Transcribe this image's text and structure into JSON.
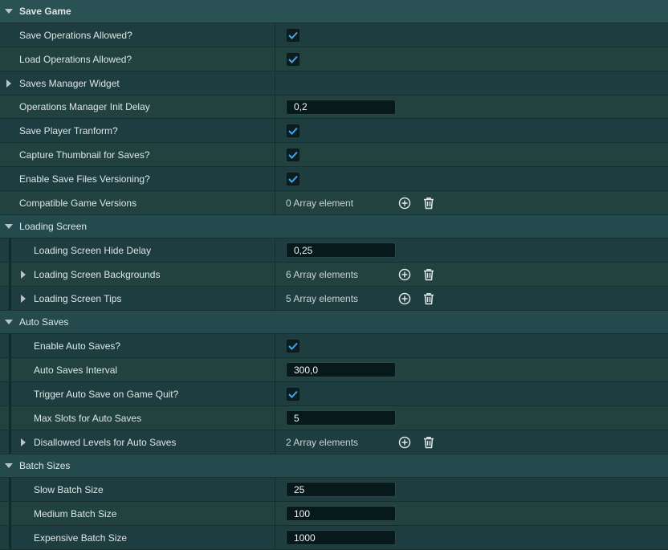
{
  "categories": {
    "save_game": "Save Game",
    "loading_screen": "Loading Screen",
    "auto_saves": "Auto Saves",
    "batch_sizes": "Batch Sizes"
  },
  "properties": {
    "save_ops": {
      "label": "Save Operations Allowed?",
      "checked": true
    },
    "load_ops": {
      "label": "Load Operations Allowed?",
      "checked": true
    },
    "saves_manager_widget": {
      "label": "Saves Manager Widget"
    },
    "ops_manager_init_delay": {
      "label": "Operations Manager Init Delay",
      "value": "0,2"
    },
    "save_player_transform": {
      "label": "Save Player Tranform?",
      "checked": true
    },
    "capture_thumbnail": {
      "label": "Capture Thumbnail for Saves?",
      "checked": true
    },
    "enable_versioning": {
      "label": "Enable Save Files Versioning?",
      "checked": true
    },
    "compatible_versions": {
      "label": "Compatible Game Versions",
      "value": "0 Array element"
    },
    "loading_hide_delay": {
      "label": "Loading Screen Hide Delay",
      "value": "0,25"
    },
    "loading_backgrounds": {
      "label": "Loading Screen Backgrounds",
      "value": "6 Array elements"
    },
    "loading_tips": {
      "label": "Loading Screen Tips",
      "value": "5 Array elements"
    },
    "enable_auto_saves": {
      "label": "Enable Auto Saves?",
      "checked": true
    },
    "auto_saves_interval": {
      "label": "Auto Saves Interval",
      "value": "300,0"
    },
    "trigger_on_quit": {
      "label": "Trigger Auto Save on Game Quit?",
      "checked": true
    },
    "max_slots": {
      "label": "Max Slots for Auto Saves",
      "value": "5"
    },
    "disallowed_levels": {
      "label": "Disallowed Levels for Auto Saves",
      "value": "2 Array elements"
    },
    "slow_batch": {
      "label": "Slow Batch Size",
      "value": "25"
    },
    "medium_batch": {
      "label": "Medium Batch Size",
      "value": "100"
    },
    "expensive_batch": {
      "label": "Expensive Batch Size",
      "value": "1000"
    }
  },
  "icons": {
    "checkmark": "checkmark-icon",
    "add": "add-element-icon",
    "trash": "trash-icon",
    "expand": "triangle-right-icon",
    "collapse": "triangle-down-icon"
  },
  "colors": {
    "background": "#1d3a3d",
    "check_accent": "#3fa6e8",
    "field_bg": "#08191b"
  }
}
